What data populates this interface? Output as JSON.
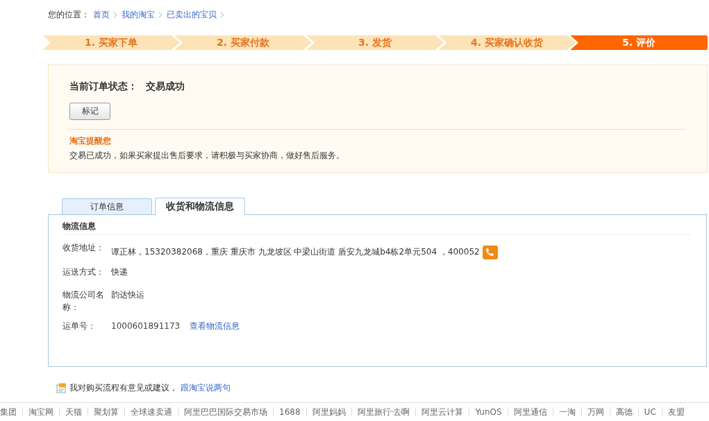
{
  "breadcrumb": {
    "label": "您的位置：",
    "links": [
      "首页",
      "我的淘宝",
      "已卖出的宝贝"
    ]
  },
  "steps": [
    {
      "label": "1. 买家下单",
      "selected": false
    },
    {
      "label": "2. 买家付款",
      "selected": false
    },
    {
      "label": "3. 发货",
      "selected": false
    },
    {
      "label": "4. 买家确认收货",
      "selected": false
    },
    {
      "label": "5. 评价",
      "selected": true
    }
  ],
  "status": {
    "label": "当前订单状态：",
    "value": "交易成功",
    "button": "标记",
    "tip_title": "淘宝提醒您",
    "tip_text": "交易已成功，如果买家提出售后要求，请积极与买家协商，做好售后服务。"
  },
  "tabs": [
    {
      "label": "订单信息",
      "selected": false
    },
    {
      "label": "收货和物流信息",
      "selected": true
    }
  ],
  "logistics": {
    "heading": "物流信息",
    "rows": [
      {
        "kind": "address",
        "label": "收货地址：",
        "value": "谭正林，15320382068，重庆 重庆市 九龙坡区 中梁山街道 盾安九龙城b4栋2单元504 ，400052"
      },
      {
        "kind": "text",
        "label": "运送方式：",
        "value": "快递"
      },
      {
        "kind": "text",
        "label": "物流公司名称：",
        "value": "韵达快运"
      },
      {
        "kind": "tracking",
        "label": "运单号：",
        "value": "1000601891173",
        "link": "查看物流信息"
      }
    ]
  },
  "feedback": {
    "text": "我对购买流程有意见或建议，",
    "link": "跟淘宝说两句"
  },
  "footer_links": [
    "集团",
    "淘宝网",
    "天猫",
    "聚划算",
    "全球速卖通",
    "阿里巴巴国际交易市场",
    "1688",
    "阿里妈妈",
    "阿里旅行·去啊",
    "阿里云计算",
    "YunOS",
    "阿里通信",
    "一淘",
    "万网",
    "高德",
    "UC",
    "友盟"
  ]
}
